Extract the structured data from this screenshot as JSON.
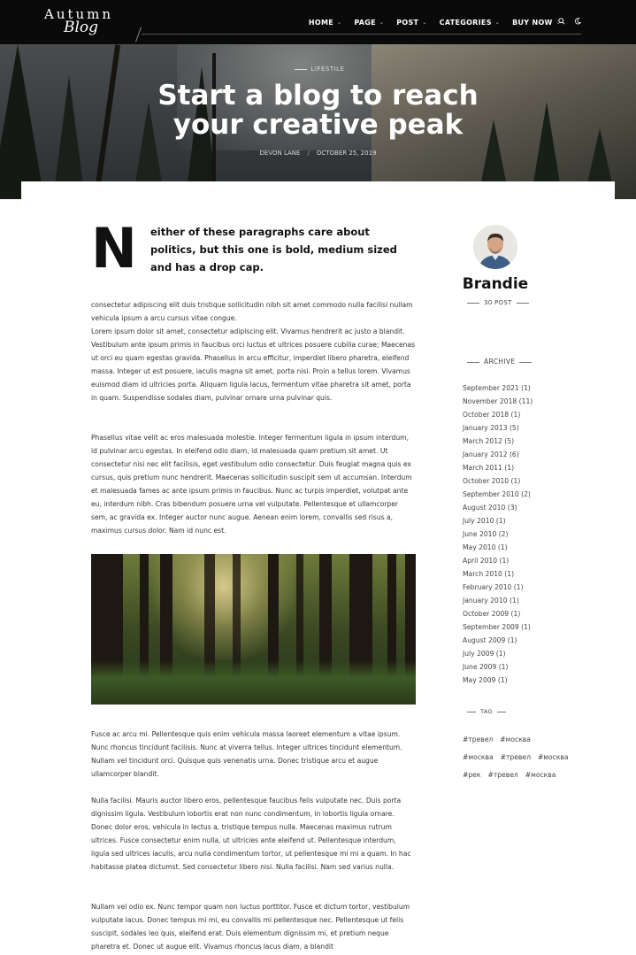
{
  "logo": {
    "top": "Autumn",
    "script": "Blog"
  },
  "nav": {
    "items": [
      {
        "label": "HOME"
      },
      {
        "label": "PAGE"
      },
      {
        "label": "POST"
      },
      {
        "label": "CATEGORIES"
      },
      {
        "label": "BUY NOW"
      }
    ],
    "icons": [
      "search-icon",
      "moon-icon"
    ]
  },
  "hero": {
    "category": "LIFESTILE",
    "title_line1": "Start a blog to reach",
    "title_line2": "your creative peak",
    "author": "DEVON LANE",
    "separator": "/",
    "date": "OCTOBER 25, 2019"
  },
  "article": {
    "dropcap": "N",
    "intro": "either of these paragraphs care about politics, but this one is bold, medium sized and has a drop cap.",
    "paragraphs": [
      "consectetur adipiscing elit duis tristique sollicitudin nibh sit amet commodo nulla facilisi nullam vehicula ipsum a arcu cursus vitae congue.",
      "Lorem ipsum dolor sit amet, consectetur adipiscing elit. Vivamus hendrerit ac justo a blandit. Vestibulum ante ipsum primis in faucibus orci luctus et ultrices posuere cubilia curae; Maecenas ut orci eu quam egestas gravida. Phasellus in arcu efficitur, imperdiet libero pharetra, eleifend massa. Integer ut est posuere, iaculis magna sit amet, porta nisi. Proin a tellus lorem. Vivamus euismod diam id ultricies porta. Aliquam ligula lacus, fermentum vitae pharetra sit amet, porta in quam. Suspendisse sodales diam, pulvinar ornare urna pulvinar quis.",
      "Phasellus vitae velit ac eros malesuada molestie. Integer fermentum ligula in ipsum interdum, id pulvinar arcu egestas. In eleifend odio diam, id malesuada quam pretium sit amet. Ut consectetur nisi nec elit facilisis, eget vestibulum odio consectetur. Duis feugiat magna quis ex cursus, quis pretium nunc hendrerit. Maecenas sollicitudin suscipit sem ut accumsan. Interdum et malesuada fames ac ante ipsum primis in faucibus. Nunc ac turpis imperdiet, volutpat ante eu, interdum nibh. Cras bibendum posuere urna vel vulputate. Pellentesque et ullamcorper sem, ac gravida ex. Integer auctor nunc augue. Aenean enim lorem, convallis sed risus a, maximus cursus dolor. Nam id nunc est.",
      "Fusce ac arcu mi. Pellentesque quis enim vehicula massa laoreet elementum a vitae ipsum. Nunc rhoncus tincidunt facilisis. Nunc at viverra tellus. Integer ultrices tincidunt elementum. Nullam vel tincidunt orci. Quisque quis venenatis urna. Donec tristique arcu et augue ullamcorper blandit.",
      "Nulla facilisi. Mauris auctor libero eros, pellentesque faucibus felis vulputate nec. Duis porta dignissim ligula. Vestibulum lobortis erat non nunc condimentum, in lobortis ligula ornare. Donec dolor eros, vehicula in lectus a, tristique tempus nulla. Maecenas maximus rutrum ultrices. Fusce consectetur enim nulla, ut ultricies ante eleifend ut. Pellentesque interdum, ligula sed ultrices iaculis, arcu nulla condimentum tortor, ut pellentesque mi mi a quam. In hac habitasse platea dictumst. Sed consectetur libero nisi. Nulla facilisi. Nam sed varius nulla.",
      "Nullam vel odio ex. Nunc tempor quam non luctus porttitor. Fusce et dictum tortor, vestibulum vulputate lacus. Donec tempus mi mi, eu convallis mi pellentesque nec. Pellentesque ut felis suscipit, sodales leo quis, eleifend erat. Duis elementum dignissim mi, et pretium neque pharetra et. Donec ut augue elit. Vivamus rhoncus lacus diam, a blandit"
    ]
  },
  "sidebar": {
    "author": {
      "name": "Brandie",
      "posts": "30 POST"
    },
    "archive_title": "ARCHIVE",
    "archive": [
      "September 2021 (1)",
      "November 2018 (11)",
      "October 2018 (1)",
      "January 2013 (5)",
      "March 2012 (5)",
      "January 2012 (6)",
      "March 2011 (1)",
      "October 2010 (1)",
      "September 2010 (2)",
      "August 2010 (3)",
      "July 2010 (1)",
      "June 2010 (2)",
      "May 2010 (1)",
      "April 2010 (1)",
      "March 2010 (1)",
      "February 2010 (1)",
      "January 2010 (1)",
      "October 2009 (1)",
      "September 2009 (1)",
      "August 2009 (1)",
      "July 2009 (1)",
      "June 2009 (1)",
      "May 2009 (1)"
    ],
    "tag_title": "TAG",
    "tags": [
      [
        "#тревел",
        "#москва"
      ],
      [
        "#москва",
        "#тревел",
        "#москва"
      ],
      [
        "#рек",
        "#тревел",
        "#москва"
      ]
    ]
  }
}
